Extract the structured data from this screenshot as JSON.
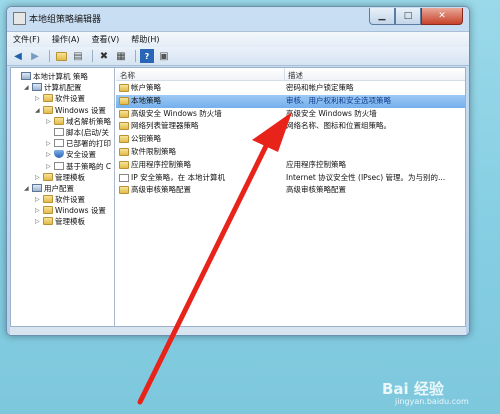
{
  "window": {
    "title": "本地组策略编辑器"
  },
  "menu": [
    "文件(F)",
    "操作(A)",
    "查看(V)",
    "帮助(H)"
  ],
  "toolbar": [
    "back-icon",
    "forward-icon",
    "up-folder-icon",
    "show-tree-icon",
    "delete-icon",
    "properties-icon",
    "help-icon",
    "view-icon"
  ],
  "tree": [
    {
      "label": "本地计算机 策略",
      "indent": 0,
      "exp": "",
      "icon": "computer"
    },
    {
      "label": "计算机配置",
      "indent": 1,
      "exp": "◢",
      "icon": "computer"
    },
    {
      "label": "软件设置",
      "indent": 2,
      "exp": "▷",
      "icon": "folder"
    },
    {
      "label": "Windows 设置",
      "indent": 2,
      "exp": "◢",
      "icon": "folder"
    },
    {
      "label": "域名解析策略",
      "indent": 3,
      "exp": "▷",
      "icon": "folder"
    },
    {
      "label": "脚本(启动/关",
      "indent": 3,
      "exp": "",
      "icon": "doc"
    },
    {
      "label": "已部署的打印",
      "indent": 3,
      "exp": "▷",
      "icon": "doc"
    },
    {
      "label": "安全设置",
      "indent": 3,
      "exp": "▷",
      "icon": "shield"
    },
    {
      "label": "基于策略的 C",
      "indent": 3,
      "exp": "▷",
      "icon": "chart"
    },
    {
      "label": "管理模板",
      "indent": 2,
      "exp": "▷",
      "icon": "folder"
    },
    {
      "label": "用户配置",
      "indent": 1,
      "exp": "◢",
      "icon": "computer"
    },
    {
      "label": "软件设置",
      "indent": 2,
      "exp": "▷",
      "icon": "folder"
    },
    {
      "label": "Windows 设置",
      "indent": 2,
      "exp": "▷",
      "icon": "folder"
    },
    {
      "label": "管理模板",
      "indent": 2,
      "exp": "▷",
      "icon": "folder"
    }
  ],
  "list": {
    "headers": [
      "名称",
      "描述"
    ],
    "rows": [
      {
        "name": "帐户策略",
        "desc": "密码和帐户锁定策略",
        "icon": "folder",
        "selected": false
      },
      {
        "name": "本地策略",
        "desc": "审核、用户权利和安全选项策略",
        "icon": "folder",
        "selected": true
      },
      {
        "name": "高级安全 Windows 防火墙",
        "desc": "高级安全 Windows 防火墙",
        "icon": "folder",
        "selected": false
      },
      {
        "name": "网络列表管理器策略",
        "desc": "网络名称、图标和位置组策略。",
        "icon": "folder",
        "selected": false
      },
      {
        "name": "公钥策略",
        "desc": "",
        "icon": "folder",
        "selected": false
      },
      {
        "name": "软件限制策略",
        "desc": "",
        "icon": "folder",
        "selected": false
      },
      {
        "name": "应用程序控制策略",
        "desc": "应用程序控制策略",
        "icon": "folder",
        "selected": false
      },
      {
        "name": "IP 安全策略，在 本地计算机",
        "desc": "Internet 协议安全性 (IPsec) 管理。为与别的...",
        "icon": "ipsec",
        "selected": false
      },
      {
        "name": "高级审核策略配置",
        "desc": "高级审核策略配置",
        "icon": "folder",
        "selected": false
      }
    ]
  },
  "watermark": {
    "text": "Bai 经验",
    "sub": "jingyan.baidu.com"
  },
  "colors": {
    "selection": "#74b0ec",
    "arrow": "#e8231a",
    "desktop": "#8fd3e6"
  }
}
